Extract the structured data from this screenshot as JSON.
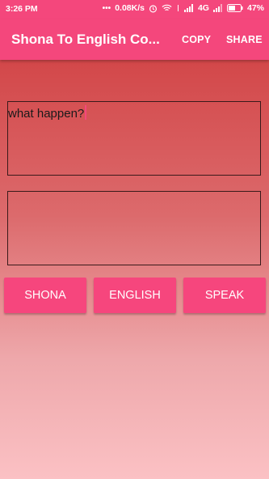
{
  "status": {
    "time": "3:26 PM",
    "speed": "0.08K/s",
    "network": "4G",
    "battery": "47%"
  },
  "appbar": {
    "title": "Shona To English Co...",
    "copy_label": "COPY",
    "share_label": "SHARE"
  },
  "input": {
    "value": "what happen?"
  },
  "output": {
    "value": ""
  },
  "buttons": {
    "shona": "SHONA",
    "english": "ENGLISH",
    "speak": "SPEAK"
  },
  "colors": {
    "accent": "#f4477c",
    "gradient_top": "#cf3a3c",
    "gradient_bottom": "#fbc1c4"
  }
}
